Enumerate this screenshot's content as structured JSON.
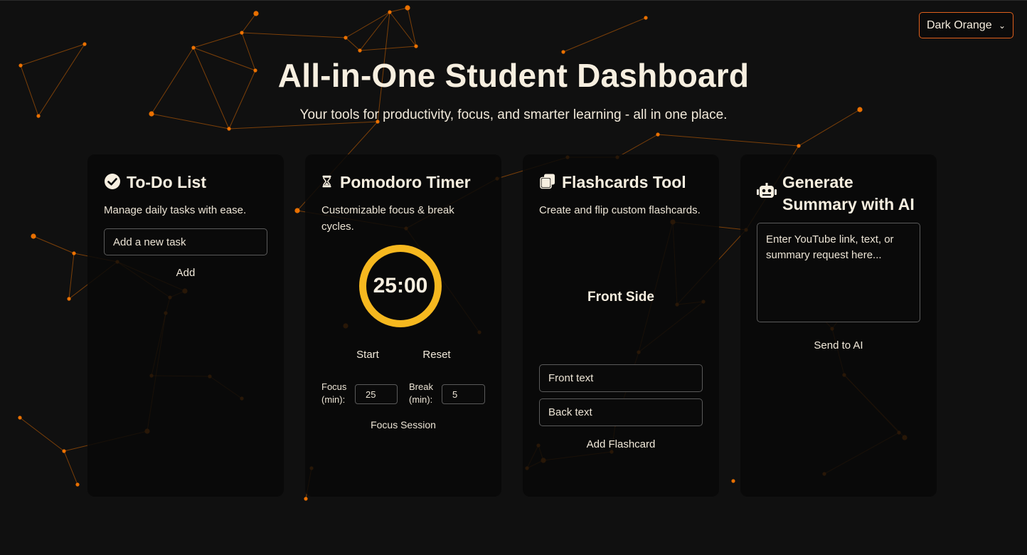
{
  "theme": {
    "selected": "Dark Orange",
    "accent": "#ff7a00",
    "ring": "#f6b81f"
  },
  "hero": {
    "title": "All-in-One Student Dashboard",
    "subtitle": "Your tools for productivity, focus, and smarter learning - all in one place."
  },
  "todo": {
    "title": "To-Do List",
    "icon": "check-circle-icon",
    "description": "Manage daily tasks with ease.",
    "input_placeholder": "Add a new task",
    "add_label": "Add"
  },
  "pomodoro": {
    "title": "Pomodoro Timer",
    "icon": "hourglass-icon",
    "description": "Customizable focus & break cycles.",
    "time": "25:00",
    "start_label": "Start",
    "reset_label": "Reset",
    "focus_label": "Focus (min):",
    "focus_value": "25",
    "break_label": "Break (min):",
    "break_value": "5",
    "session_label": "Focus Session"
  },
  "flashcards": {
    "title": "Flashcards Tool",
    "icon": "cards-icon",
    "description": "Create and flip custom flashcards.",
    "card_face": "Front Side",
    "front_placeholder": "Front text",
    "back_placeholder": "Back text",
    "add_label": "Add Flashcard"
  },
  "ai": {
    "title": "Generate Summary with AI",
    "icon": "robot-icon",
    "textarea_placeholder": "Enter YouTube link, text, or summary request here...",
    "send_label": "Send to AI"
  }
}
